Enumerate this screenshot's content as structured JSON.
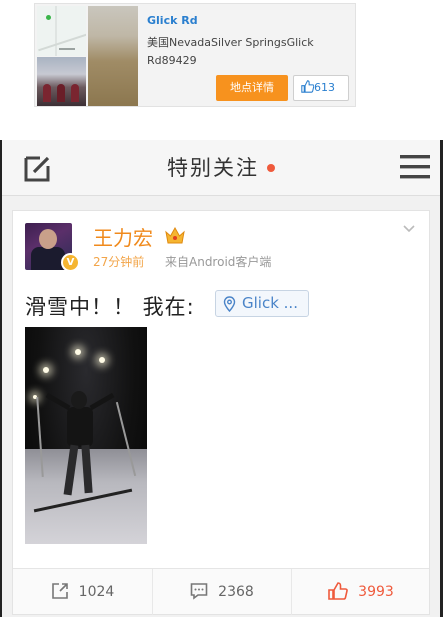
{
  "location_card": {
    "title": "Glick Rd",
    "address": "美国NevadaSilver SpringsGlick Rd89429",
    "detail_button": "地点详情",
    "like_count": "613"
  },
  "header": {
    "title": "特别关注"
  },
  "post": {
    "author": "王力宏",
    "verified_badge": "V",
    "time": "27分钟前",
    "source": "来自Android客户端",
    "text": "滑雪中！！ 我在:",
    "location_chip": "Glick ...",
    "actions": {
      "repost_count": "1024",
      "comment_count": "2368",
      "like_count": "3993"
    }
  },
  "colors": {
    "accent_orange": "#f7921e",
    "link_blue": "#2a7fcf",
    "like_red": "#ef5a3c",
    "author_orange": "#f08a1c"
  }
}
